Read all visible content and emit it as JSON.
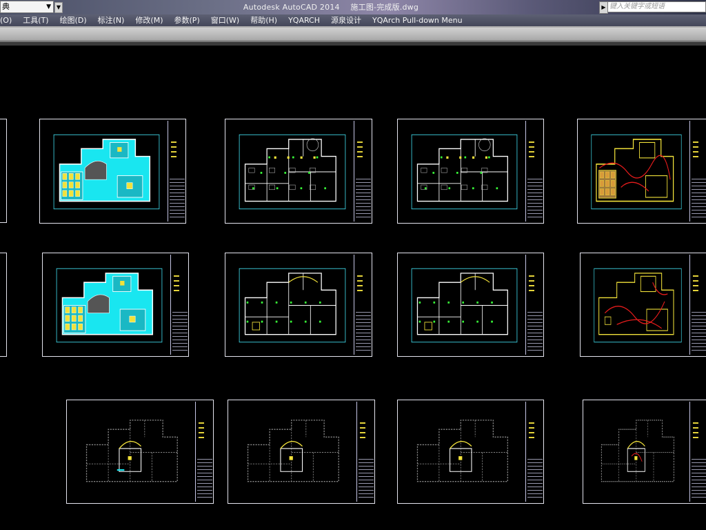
{
  "titlebar": {
    "workspace": "典",
    "app": "Autodesk AutoCAD 2014",
    "file": "施工图-完成版.dwg",
    "search_placeholder": "键入关键字或短语"
  },
  "menu": [
    "(O)",
    "工具(T)",
    "绘图(D)",
    "标注(N)",
    "修改(M)",
    "参数(P)",
    "窗口(W)",
    "帮助(H)",
    "YQARCH",
    "源泉设计",
    "YQArch Pull-down Menu"
  ],
  "colors": {
    "floor_fill_cyan": "#19e6f0",
    "wall_white": "#ffffff",
    "furniture_green": "#39ff39",
    "fixture_yellow": "#f2e23a",
    "circuit_red": "#e81c1c",
    "ceiling_brown": "#a07a3a",
    "sheet_border": "#e6e6f0"
  },
  "sheets": [
    {
      "name": "sheet-color-floor-plan-1",
      "style": "cyan"
    },
    {
      "name": "sheet-furniture-plan-1",
      "style": "furniture"
    },
    {
      "name": "sheet-furniture-plan-2",
      "style": "furniture2"
    },
    {
      "name": "sheet-ceiling-plan-1",
      "style": "ceilingred"
    },
    {
      "name": "sheet-color-floor-plan-2",
      "style": "cyan2"
    },
    {
      "name": "sheet-wall-plan-1",
      "style": "wall"
    },
    {
      "name": "sheet-wall-plan-2",
      "style": "wall2"
    },
    {
      "name": "sheet-electrical-plan-1",
      "style": "electrical"
    },
    {
      "name": "sheet-dashed-plan-1",
      "style": "dashed"
    },
    {
      "name": "sheet-dashed-plan-2",
      "style": "dashed2"
    },
    {
      "name": "sheet-dashed-plan-3",
      "style": "dashed3"
    },
    {
      "name": "sheet-dashed-plan-4",
      "style": "dashed4"
    }
  ]
}
